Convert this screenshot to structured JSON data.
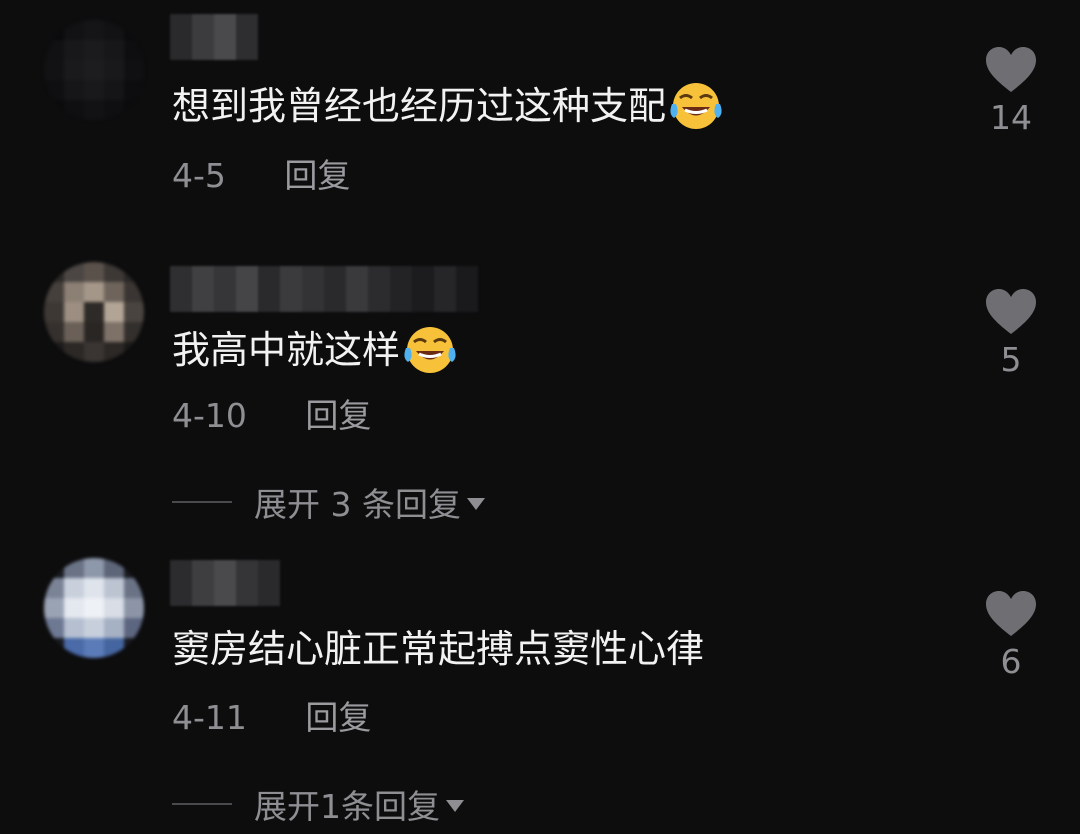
{
  "comments": [
    {
      "text": "想到我曾经也经历过这种支配",
      "has_emoji": true,
      "emoji": "face-with-tears-of-joy-icon",
      "date": "4-5",
      "reply_label": "回复",
      "likes": "14"
    },
    {
      "text": "我高中就这样",
      "has_emoji": true,
      "emoji": "face-with-tears-of-joy-icon",
      "date": "4-10",
      "reply_label": "回复",
      "likes": "5",
      "expand_label": "展开 3 条回复"
    },
    {
      "text": "窦房结心脏正常起搏点窦性心律",
      "has_emoji": false,
      "date": "4-11",
      "reply_label": "回复",
      "likes": "6",
      "expand_label": "展开1条回复"
    }
  ],
  "colors": {
    "background": "#0d0d0e",
    "text_primary": "#f2f2f2",
    "text_secondary": "#8e8e93",
    "heart": "#6e6e73"
  }
}
